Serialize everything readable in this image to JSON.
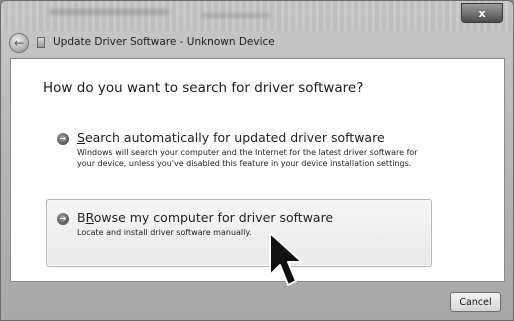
{
  "window": {
    "title": "Update Driver Software - Unknown Device",
    "close_label": "x"
  },
  "main": {
    "heading": "How do you want to search for driver software?",
    "options": [
      {
        "accel": "S",
        "label_rest": "earch automatically for updated driver software",
        "description": "Windows will search your computer and the Internet for the latest driver software for your device, unless you've disabled this feature in your device installation settings."
      },
      {
        "accel": "R",
        "label_rest": "owse my computer for driver software",
        "label_prefix": "B",
        "description": "Locate and install driver software manually."
      }
    ]
  },
  "footer": {
    "cancel_label": "Cancel"
  },
  "icons": {
    "option_arrow": "arrow-right-icon",
    "back": "back-arrow-icon",
    "cursor": "mouse-pointer-icon"
  }
}
